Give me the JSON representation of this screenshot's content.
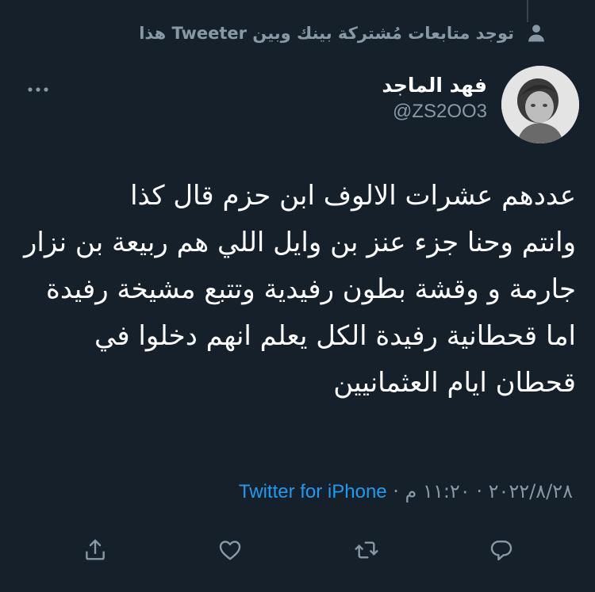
{
  "social_context": {
    "text": "توجد متابعات مُشتركة بينك وبين Tweeter هذا",
    "icon": "person-icon"
  },
  "author": {
    "display_name": "فهد الماجد",
    "handle": "@ZS2OO3"
  },
  "tweet": {
    "text": "عددهم عشرات الالوف ابن حزم قال كذا\nوانتم وحنا جزء عنز بن وايل اللي هم ربيعة بن نزار\nجارمة و وقشة بطون رفيدية وتتبع مشيخة رفيدة اما قحطانية رفيدة الكل يعلم انهم دخلوا في قحطان ايام العثمانيين"
  },
  "meta": {
    "date_time": "٢٠٢٢/٨/٢٨ · ١١:٢٠ م",
    "separator": " · ",
    "source": "Twitter for iPhone"
  },
  "actions": {
    "reply": "reply-icon",
    "retweet": "retweet-icon",
    "like": "heart-icon",
    "share": "share-icon"
  },
  "colors": {
    "background": "#15202b",
    "secondary_text": "#8899a6",
    "link": "#1d9bf0"
  }
}
